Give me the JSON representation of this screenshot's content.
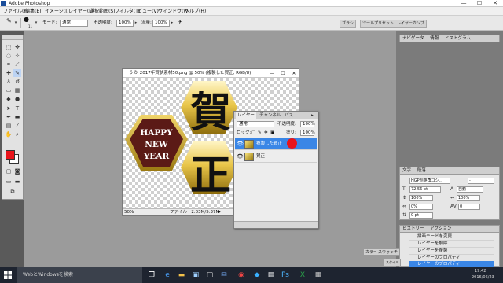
{
  "app": {
    "title": "Adobe Photoshop",
    "window_controls": [
      "—",
      "☐",
      "✕"
    ]
  },
  "menu": [
    "ファイル(F)",
    "編集(E)",
    "イメージ(I)",
    "レイヤー(L)",
    "選択範囲(S)",
    "フィルタ(T)",
    "ビュー(V)",
    "ウィンドウ(W)",
    "ヘルプ(H)"
  ],
  "options": {
    "mode_label": "モード:",
    "mode_value": "通常",
    "opacity_label": "不透明度:",
    "opacity_value": "100%",
    "flow_label": "流量:",
    "flow_value": "100%",
    "brush_size": "11",
    "dock_tabs": [
      "ブラシ",
      "ツールプリセット",
      "レイヤーカンプ"
    ]
  },
  "document": {
    "title": "うの_2017年賀状素材50.png @ 50% (複製した賀正, RGB/8)",
    "zoom": "50%",
    "file_info": "ファイル : 2.03M/5.37M",
    "hex_text_lines": [
      "HAPPY",
      "NEW",
      "YEAR"
    ],
    "kanji": [
      "賀",
      "正"
    ]
  },
  "layers_panel": {
    "tabs": [
      "レイヤー",
      "チャンネル",
      "パス"
    ],
    "blend_mode": "通常",
    "opacity_label": "不透明度:",
    "opacity_value": "100%",
    "lock_label": "ロック:",
    "fill_label": "塗り:",
    "fill_value": "100%",
    "layers": [
      {
        "name": "複製した賀正",
        "selected": true
      },
      {
        "name": "賀正",
        "selected": false
      }
    ],
    "cursor_color": "#e8141b"
  },
  "dock": {
    "navigator_tabs": [
      "ナビゲータ",
      "情報",
      "ヒストグラム"
    ],
    "character_tabs": [
      "文字",
      "段落"
    ],
    "font_family": "HGP創英角ゴシ...",
    "font_style": "-",
    "font_size": "72.56 pt",
    "leading": "自動",
    "vertical_scale": "100%",
    "horizontal_scale": "100%",
    "tracking": "0%",
    "baseline": "0 pt",
    "kerning": "0",
    "history_tabs": [
      "ヒストリー",
      "アクション"
    ],
    "history_items": [
      {
        "label": "描画モードを変更",
        "selected": false
      },
      {
        "label": "レイヤーを削除",
        "selected": false
      },
      {
        "label": "レイヤーを複製",
        "selected": false
      },
      {
        "label": "レイヤーのプロパティ",
        "selected": false
      },
      {
        "label": "レイヤーのプロパティ",
        "selected": true
      }
    ],
    "bottom_tabs": [
      "カラー",
      "スウォッチ",
      "スタイル"
    ]
  },
  "taskbar": {
    "search_placeholder": "WebとWindowsを検索",
    "time": "19:42",
    "date": "2016/06/23"
  },
  "colors": {
    "selection_blue": "#3a86e6",
    "foreground": "#e8141b",
    "background": "#ffffff"
  }
}
